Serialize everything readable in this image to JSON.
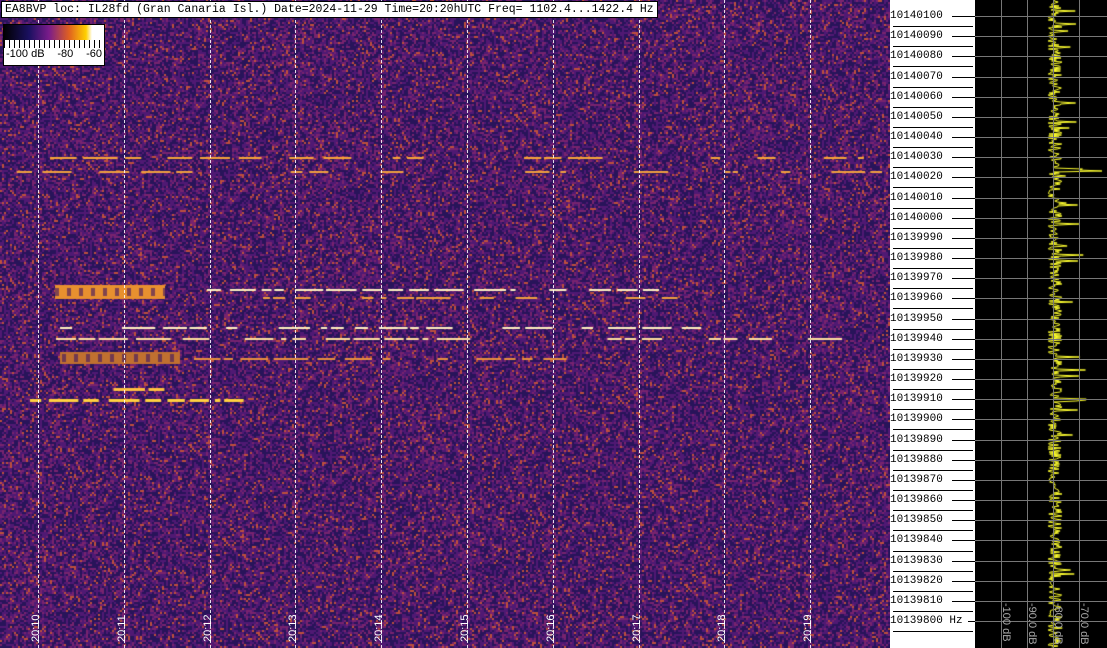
{
  "header": {
    "title": "EA8BVP loc: IL28fd (Gran Canaria Isl.) Date=2024-11-29 Time=20:20hUTC Freq= 1102.4...1422.4 Hz"
  },
  "colorbar": {
    "labels": [
      "-100 dB",
      "-80",
      "-60"
    ],
    "colors": [
      "#000000",
      "#1a1060",
      "#7a1c8a",
      "#e06020",
      "#ffd000",
      "#ffffff"
    ]
  },
  "time_labels": [
    "20:10",
    "20:11",
    "20:12",
    "20:13",
    "20:14",
    "20:15",
    "20:16",
    "20:17",
    "20:18",
    "20:19"
  ],
  "freq_labels": [
    "10140100",
    "10140090",
    "10140080",
    "10140070",
    "10140060",
    "10140050",
    "10140040",
    "10140030",
    "10140020",
    "10140010",
    "10140000",
    "10139990",
    "10139980",
    "10139970",
    "10139960",
    "10139950",
    "10139940",
    "10139930",
    "10139920",
    "10139910",
    "10139900",
    "10139890",
    "10139880",
    "10139870",
    "10139860",
    "10139850",
    "10139840",
    "10139830",
    "10139820",
    "10139810",
    "10139800 Hz"
  ],
  "spectrum": {
    "db_labels": [
      "-100 dB",
      "-90.0 dB",
      "-80.0 dB",
      "-70.0 dB"
    ],
    "trace_color": "#ffff30"
  }
}
